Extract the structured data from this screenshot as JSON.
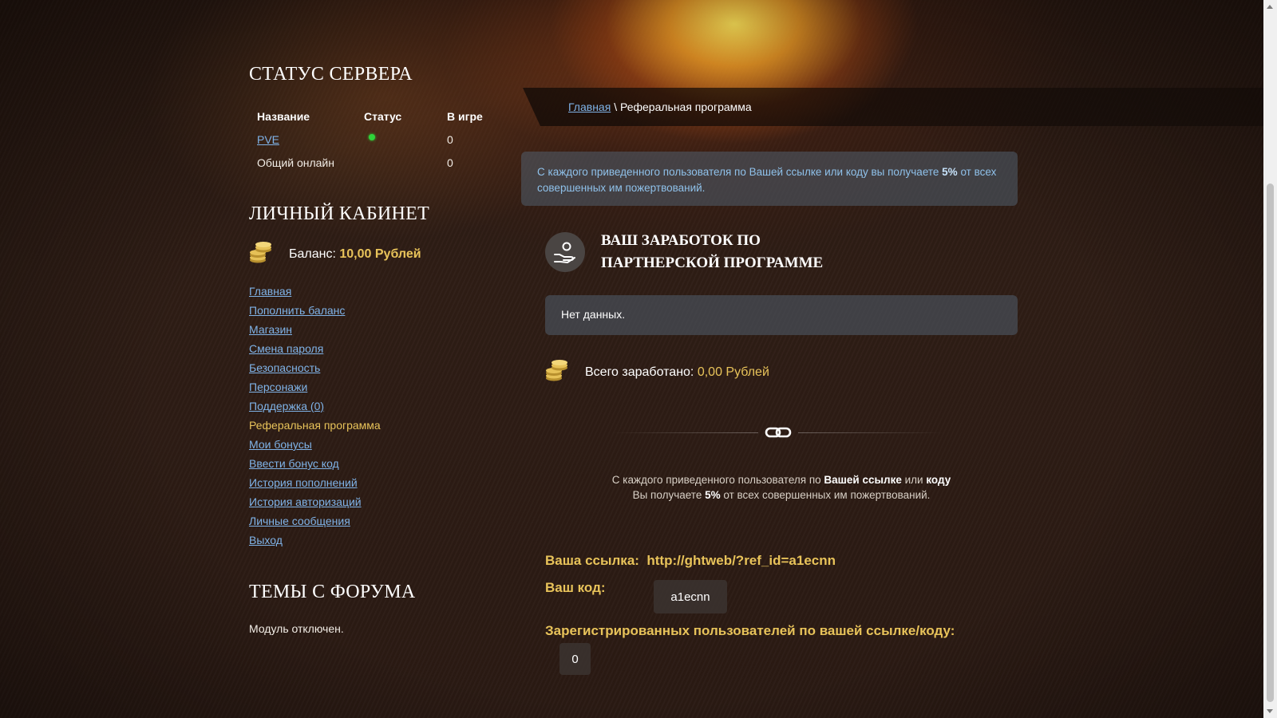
{
  "sidebar": {
    "server_status_title": "СТАТУС СЕРВЕРА",
    "server_table": {
      "headers": [
        "Название",
        "Статус",
        "В игре"
      ],
      "rows": [
        {
          "name": "PVE",
          "status": "online",
          "in_game": "0"
        },
        {
          "name": "Общий онлайн",
          "in_game": "0"
        }
      ]
    },
    "cabinet_title": "ЛИЧНЫЙ КАБИНЕТ",
    "balance": {
      "label": "Баланс:",
      "amount": "10,00",
      "currency": "Рублей"
    },
    "menu": [
      {
        "label": "Главная"
      },
      {
        "label": "Пополнить баланс"
      },
      {
        "label": "Магазин"
      },
      {
        "label": "Смена пароля"
      },
      {
        "label": "Безопасность"
      },
      {
        "label": "Персонажи"
      },
      {
        "label": "Поддержка (0)"
      },
      {
        "label": "Реферальная программа",
        "active": true
      },
      {
        "label": "Мои бонусы"
      },
      {
        "label": "Ввести бонус код"
      },
      {
        "label": "История пополнений"
      },
      {
        "label": "История авторизаций"
      },
      {
        "label": "Личные сообщения"
      },
      {
        "label": "Выход"
      }
    ],
    "forum_title": "ТЕМЫ С ФОРУМА",
    "forum_text": "Модуль отключен."
  },
  "breadcrumb": {
    "home": "Главная",
    "separator": "\\",
    "current": "Реферальная программа"
  },
  "info": {
    "text_before": "С каждого приведенного пользователя по Вашей ссылке или коду вы получаете ",
    "percent": "5%",
    "text_after": " от всех совершенных им пожертвований."
  },
  "earnings": {
    "title": "ВАШ ЗАРАБОТОК ПО ПАРТНЕРСКОЙ ПРОГРАММЕ",
    "no_data": "Нет данных.",
    "total_label": "Всего заработано:",
    "total_amount": "0,00",
    "total_currency": "Рублей"
  },
  "promo": {
    "p1": "С каждого приведенного пользователя по ",
    "b1": "Вашей ссылке",
    "p2": " или ",
    "b2": "коду",
    "p3": "Вы получаете ",
    "b3": "5%",
    "p4": " от всех совершенных им пожертвований."
  },
  "referral": {
    "link_label": "Ваша ссылка:",
    "link_value": "http://ghtweb/?ref_id=a1ecnn",
    "code_label": "Ваш код:",
    "code_value": "a1ecnn",
    "registered_label": "Зарегистрированных пользователей по вашей ссылке/коду:",
    "registered_count": "0"
  },
  "colors": {
    "accent_gold": "#e8c35a",
    "link_blue": "#7fb3e8",
    "status_online": "#2fd43a"
  },
  "icons": {
    "coins": "coins-icon",
    "hand": "hand-coin-icon",
    "chain": "chain-link-icon"
  }
}
